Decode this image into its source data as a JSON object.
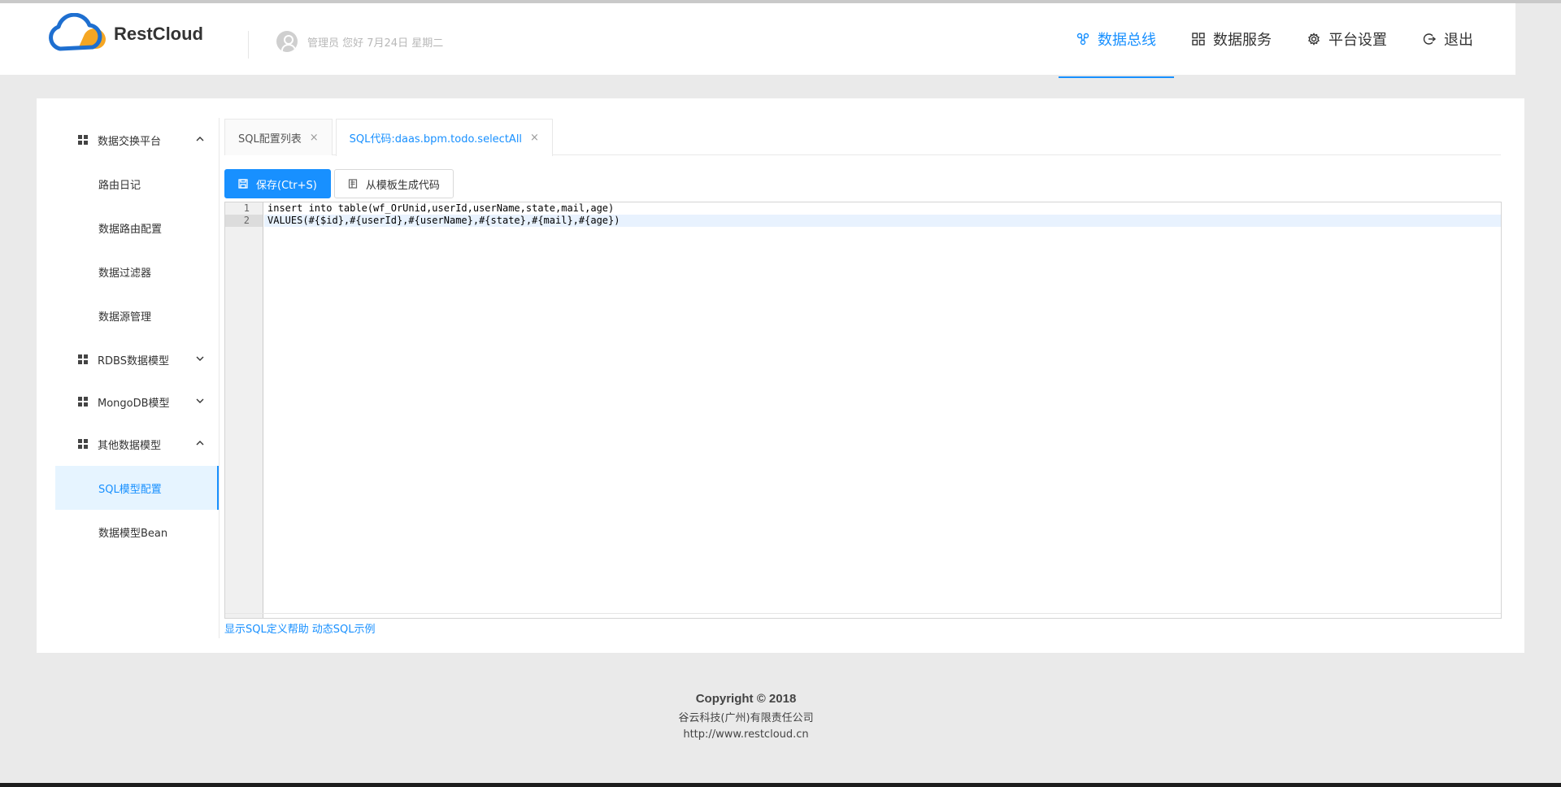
{
  "app": {
    "logo_text": "RestCloud",
    "user_greeting": "管理员 您好 7月24日 星期二"
  },
  "nav": [
    {
      "label": "数据总线",
      "icon": "cluster-icon",
      "active": true
    },
    {
      "label": "数据服务",
      "icon": "appstore-icon",
      "active": false
    },
    {
      "label": "平台设置",
      "icon": "gear-icon",
      "active": false
    },
    {
      "label": "退出",
      "icon": "logout-icon",
      "active": false
    }
  ],
  "sidebar": {
    "groups": [
      {
        "label": "数据交换平台",
        "expanded": true,
        "items": [
          "路由日记",
          "数据路由配置",
          "数据过滤器",
          "数据源管理"
        ]
      },
      {
        "label": "RDBS数据模型",
        "expanded": false,
        "items": []
      },
      {
        "label": "MongoDB模型",
        "expanded": false,
        "items": []
      },
      {
        "label": "其他数据模型",
        "expanded": true,
        "items": [
          "SQL模型配置",
          "数据模型Bean"
        ]
      }
    ],
    "selected_item": "SQL模型配置"
  },
  "tabs": [
    {
      "label": "SQL配置列表",
      "close": "×",
      "active": false
    },
    {
      "label": "SQL代码:daas.bpm.todo.selectAll",
      "close": "×",
      "active": true
    }
  ],
  "toolbar": {
    "save_label": "保存(Ctr+S)",
    "template_label": "从模板生成代码"
  },
  "editor": {
    "lines": [
      {
        "number": "1",
        "text": "insert into table(wf_OrUnid,userId,userName,state,mail,age)"
      },
      {
        "number": "2",
        "text": "VALUES(#{$id},#{userId},#{userName},#{state},#{mail},#{age})"
      }
    ],
    "current_line": 2
  },
  "help": {
    "sql_help": "显示SQL定义帮助",
    "dynamic_example": "动态SQL示例"
  },
  "footer": {
    "copyright": "Copyright © 2018",
    "company": "谷云科技(广州)有限责任公司",
    "url": "http://www.restcloud.cn"
  },
  "colors": {
    "accent": "#1890ff",
    "logo_blue": "#1e6fd0",
    "logo_orange": "#f5a623",
    "page_bg": "#eaeaea"
  }
}
